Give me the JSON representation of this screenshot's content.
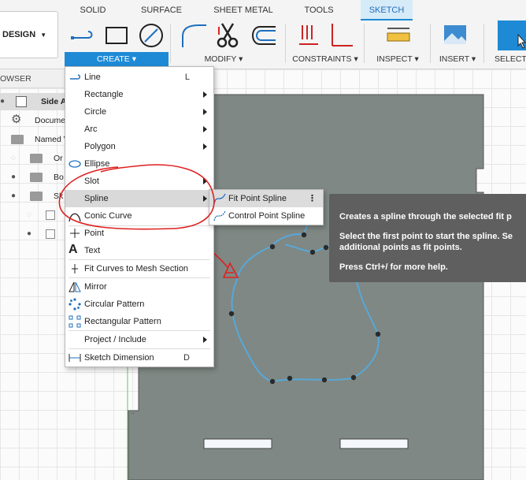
{
  "tabs": [
    {
      "label": "SOLID",
      "active": false
    },
    {
      "label": "SURFACE",
      "active": false
    },
    {
      "label": "SHEET METAL",
      "active": false
    },
    {
      "label": "TOOLS",
      "active": false
    },
    {
      "label": "SKETCH",
      "active": true
    }
  ],
  "workspace": {
    "label": "DESIGN"
  },
  "groups": {
    "create": "CREATE",
    "modify": "MODIFY",
    "constraints": "CONSTRAINTS",
    "inspect": "INSPECT",
    "insert": "INSERT",
    "select": "SELECT"
  },
  "browser": {
    "header": "OWSER",
    "rows": [
      {
        "label": "Side A"
      },
      {
        "label": "Docume"
      },
      {
        "label": "Named V"
      },
      {
        "label": "Or"
      },
      {
        "label": "Bo"
      },
      {
        "label": "Sk"
      }
    ]
  },
  "create_menu": {
    "items": [
      {
        "label": "Line",
        "shortcut": "L"
      },
      {
        "label": "Rectangle"
      },
      {
        "label": "Circle"
      },
      {
        "label": "Arc"
      },
      {
        "label": "Polygon"
      },
      {
        "label": "Ellipse"
      },
      {
        "label": "Slot"
      },
      {
        "label": "Spline"
      },
      {
        "label": "Conic Curve"
      },
      {
        "label": "Point"
      },
      {
        "label": "Text"
      },
      {
        "label": "Fit Curves to Mesh Section"
      },
      {
        "label": "Mirror"
      },
      {
        "label": "Circular Pattern"
      },
      {
        "label": "Rectangular Pattern"
      },
      {
        "label": "Project / Include"
      },
      {
        "label": "Sketch Dimension",
        "shortcut": "D"
      }
    ]
  },
  "spline_submenu": {
    "items": [
      {
        "label": "Fit Point Spline"
      },
      {
        "label": "Control Point Spline"
      }
    ]
  },
  "tooltip": {
    "line1": "Creates a spline through the selected fit p",
    "line2": "Select the first point to start the spline. Se",
    "line3": "additional points as fit points.",
    "line4": "Press Ctrl+/ for more help."
  },
  "annotation": {
    "label": "A"
  }
}
